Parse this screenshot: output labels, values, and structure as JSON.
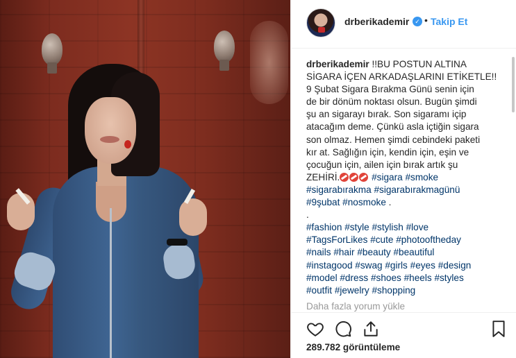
{
  "post": {
    "username": "drberikademir",
    "follow_label": "Takip Et",
    "separator": "•",
    "caption_lines": [
      "!!BU POSTUN ALTINA",
      "SİGARA İÇEN ARKADAŞLARINI ETİKETLE!!",
      "9 Şubat Sigara Bırakma Günü senin için",
      "de bir dönüm noktası olsun. Bugün şimdi",
      "şu an sigarayı bırak. Son sigaramı içip",
      "atacağım deme. Çünkü asla içtiğin sigara",
      "son olmaz. Hemen şimdi cebindeki paketi",
      "kır at. Sağlığın için, kendin için, eşin ve",
      "çocuğun için, ailen için bırak artık şu",
      "ZEHİRİ."
    ],
    "hashtags_line1": [
      "#sigara",
      "#smoke"
    ],
    "hashtags_line2": [
      "#sigarabırakma",
      "#sigarabırakmagünü"
    ],
    "hashtags_line3": [
      "#9şubat",
      "#nosmoke"
    ],
    "line3_suffix": " .",
    "period_line": ".",
    "tag_rows": [
      [
        "#fashion",
        "#style",
        "#stylish",
        "#love"
      ],
      [
        "#TagsForLikes",
        "#cute",
        "#photooftheday"
      ],
      [
        "#nails",
        "#hair",
        "#beauty",
        "#beautiful"
      ],
      [
        "#instagood",
        "#swag",
        "#girls",
        "#eyes",
        "#design"
      ],
      [
        "#model",
        "#dress",
        "#shoes",
        "#heels",
        "#styles"
      ],
      [
        "#outfit",
        "#jewelry",
        "#shopping"
      ]
    ],
    "load_more": "Daha fazla yorum yükle",
    "views": "289.782 görüntüleme"
  },
  "icons": {
    "verified": "verified-badge-icon",
    "like": "heart-icon",
    "comment": "comment-bubble-icon",
    "share": "share-upload-icon",
    "save": "bookmark-icon"
  },
  "colors": {
    "link_blue": "#3897f0",
    "hashtag": "#003569",
    "muted": "#999999"
  }
}
